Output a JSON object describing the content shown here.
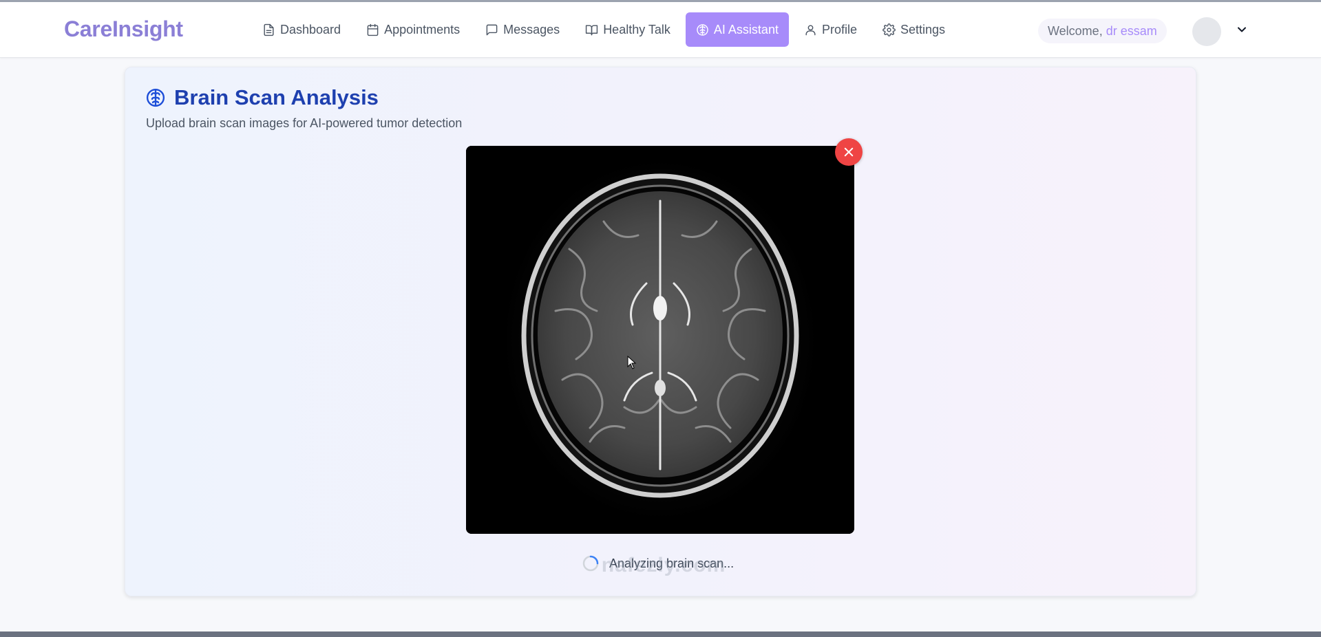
{
  "brand": "CareInsight",
  "nav": {
    "items": [
      {
        "label": "Dashboard",
        "icon": "file-text-icon",
        "active": false
      },
      {
        "label": "Appointments",
        "icon": "calendar-icon",
        "active": false
      },
      {
        "label": "Messages",
        "icon": "message-square-icon",
        "active": false
      },
      {
        "label": "Healthy Talk",
        "icon": "book-open-icon",
        "active": false
      },
      {
        "label": "AI Assistant",
        "icon": "brain-icon",
        "active": true
      },
      {
        "label": "Profile",
        "icon": "user-icon",
        "active": false
      },
      {
        "label": "Settings",
        "icon": "gear-icon",
        "active": false
      }
    ]
  },
  "user": {
    "welcome_prefix": "Welcome,",
    "name": "dr essam"
  },
  "card": {
    "title": "Brain Scan Analysis",
    "subtitle": "Upload brain scan images for AI-powered tumor detection",
    "status": "Analyzing brain scan..."
  },
  "watermark": "nafezly.com",
  "colors": {
    "brand": "#8b7fd6",
    "active_nav": "#a78bfa",
    "title": "#1e40af",
    "remove_button": "#ef4444",
    "spinner": "#3b82f6"
  }
}
